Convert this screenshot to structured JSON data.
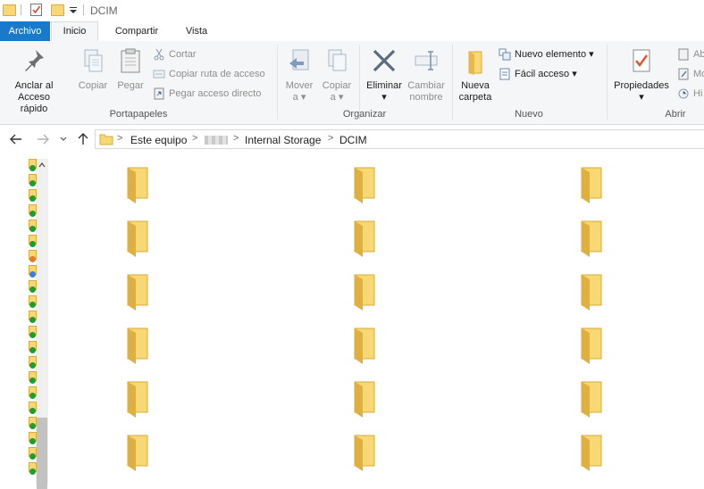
{
  "window": {
    "title": "DCIM",
    "quick_access_icons": [
      "folder-icon",
      "properties-check-icon",
      "new-folder-icon",
      "customize-dropdown-icon"
    ]
  },
  "tabs": [
    {
      "label": "Archivo",
      "active": false
    },
    {
      "label": "Inicio",
      "active": true
    },
    {
      "label": "Compartir",
      "active": false
    },
    {
      "label": "Vista",
      "active": false
    }
  ],
  "ribbon": {
    "portapapeles": {
      "label": "Portapapeles",
      "pin_label_1": "Anclar al",
      "pin_label_2": "Acceso rápido",
      "copy_label": "Copiar",
      "paste_label": "Pegar",
      "cut_label": "Cortar",
      "copy_path_label": "Copiar ruta de acceso",
      "paste_shortcut_label": "Pegar acceso directo"
    },
    "organizar": {
      "label": "Organizar",
      "move_label_1": "Mover",
      "move_label_2": "a",
      "copyto_label_1": "Copiar",
      "copyto_label_2": "a",
      "delete_label": "Eliminar",
      "rename_label_1": "Cambiar",
      "rename_label_2": "nombre"
    },
    "nuevo": {
      "label": "Nuevo",
      "new_folder_label_1": "Nueva",
      "new_folder_label_2": "carpeta",
      "new_item_label": "Nuevo elemento",
      "easy_access_label": "Fácil acceso"
    },
    "abrir": {
      "label": "Abrir",
      "properties_label": "Propiedades",
      "open_label": "Ab",
      "modify_label": "Mo",
      "history_label": "Hi"
    }
  },
  "address_bar": {
    "crumbs": [
      "Este equipo",
      "Internal Storage",
      "DCIM"
    ]
  },
  "nav_pane": {
    "badges": [
      "green",
      "green",
      "green",
      "green",
      "green",
      "green",
      "orange",
      "blue",
      "green",
      "green",
      "green",
      "green",
      "green",
      "green",
      "green",
      "green",
      "green",
      "green",
      "green",
      "green",
      "green"
    ]
  },
  "content": {
    "folder_count": 18,
    "columns": 3,
    "rows": 6,
    "folder_color": "#f8d775"
  },
  "colors": {
    "accent": "#1979ca",
    "ribbon_bg": "#f5f6f7",
    "folder": "#f8d775",
    "folder_dark": "#e0b03e"
  }
}
